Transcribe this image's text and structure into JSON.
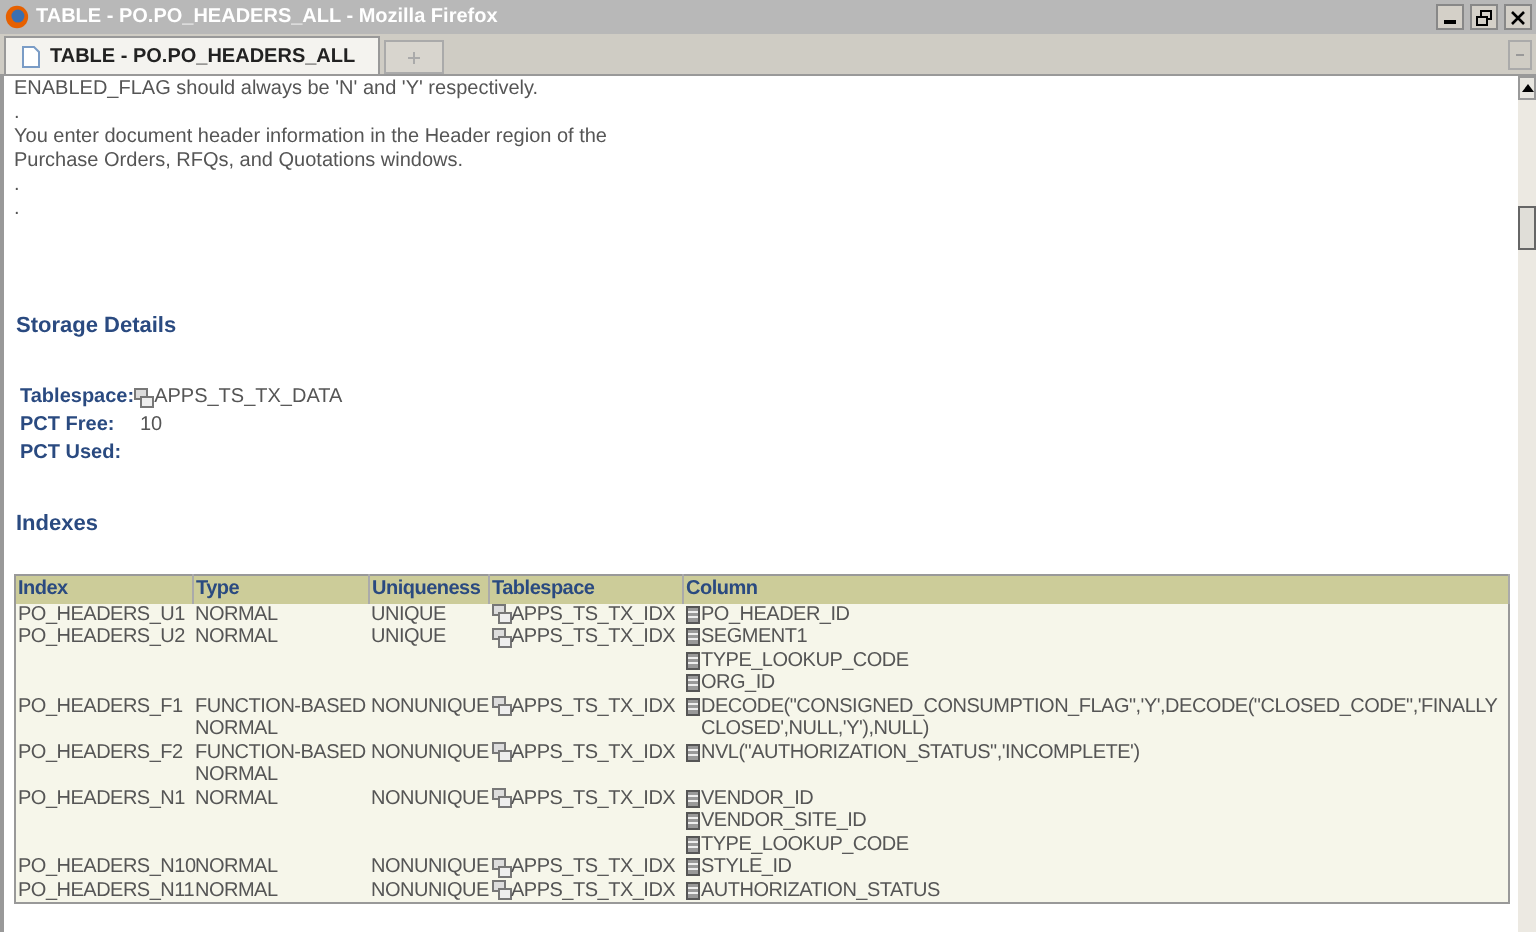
{
  "window": {
    "title": "TABLE - PO.PO_HEADERS_ALL - Mozilla Firefox"
  },
  "tabs": [
    {
      "label": "TABLE - PO.PO_HEADERS_ALL",
      "selected": true
    }
  ],
  "description": [
    "ENABLED_FLAG should always be 'N' and 'Y' respectively.",
    ".",
    "You enter document header information in the Header region of the",
    "Purchase Orders, RFQs, and Quotations windows.",
    ".",
    "."
  ],
  "storage": {
    "heading": "Storage Details",
    "fields": [
      {
        "label": "Tablespace:",
        "value": "APPS_TS_TX_DATA",
        "kind": "tablespace"
      },
      {
        "label": "PCT Free:",
        "value": "10",
        "kind": "plain"
      },
      {
        "label": "PCT Used:",
        "kind": "plain"
      }
    ]
  },
  "indexes": {
    "heading": "Indexes",
    "columns": [
      "Index",
      "Type",
      "Uniqueness",
      "Tablespace",
      "Column"
    ],
    "rows": [
      {
        "index": "PO_HEADERS_U1",
        "type": "NORMAL",
        "uniqueness": "UNIQUE",
        "tablespace": "APPS_TS_TX_IDX",
        "columns": [
          "PO_HEADER_ID"
        ]
      },
      {
        "index": "PO_HEADERS_U2",
        "type": "NORMAL",
        "uniqueness": "UNIQUE",
        "tablespace": "APPS_TS_TX_IDX",
        "columns": [
          "SEGMENT1",
          "TYPE_LOOKUP_CODE",
          "ORG_ID"
        ]
      },
      {
        "index": "PO_HEADERS_F1",
        "type": "FUNCTION-BASED NORMAL",
        "uniqueness": "NONUNIQUE",
        "tablespace": "APPS_TS_TX_IDX",
        "columns": [
          "DECODE(\"CONSIGNED_CONSUMPTION_FLAG\",'Y',DECODE(\"CLOSED_CODE\",'FINALLY CLOSED',NULL,'Y'),NULL)"
        ]
      },
      {
        "index": "PO_HEADERS_F2",
        "type": "FUNCTION-BASED NORMAL",
        "uniqueness": "NONUNIQUE",
        "tablespace": "APPS_TS_TX_IDX",
        "columns": [
          "NVL(\"AUTHORIZATION_STATUS\",'INCOMPLETE')"
        ]
      },
      {
        "index": "PO_HEADERS_N1",
        "type": "NORMAL",
        "uniqueness": "NONUNIQUE",
        "tablespace": "APPS_TS_TX_IDX",
        "columns": [
          "VENDOR_ID",
          "VENDOR_SITE_ID",
          "TYPE_LOOKUP_CODE"
        ]
      },
      {
        "index": "PO_HEADERS_N10",
        "type": "NORMAL",
        "uniqueness": "NONUNIQUE",
        "tablespace": "APPS_TS_TX_IDX",
        "columns": [
          "STYLE_ID"
        ]
      },
      {
        "index": "PO_HEADERS_N11",
        "type": "NORMAL",
        "uniqueness": "NONUNIQUE",
        "tablespace": "APPS_TS_TX_IDX",
        "columns": [
          "AUTHORIZATION_STATUS"
        ]
      }
    ]
  }
}
